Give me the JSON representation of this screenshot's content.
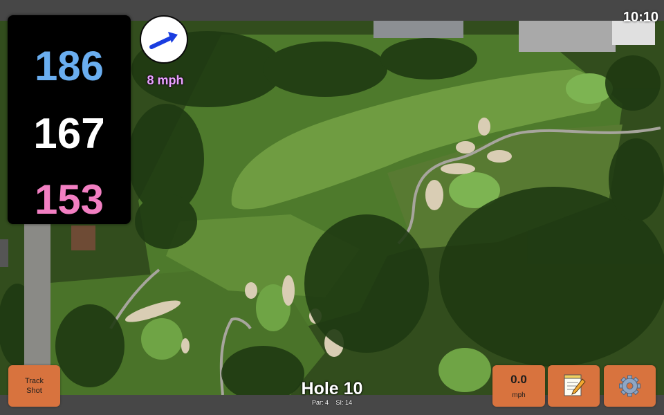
{
  "status_bar": {
    "time": "10:10"
  },
  "distances": {
    "back": "186",
    "middle": "167",
    "front": "153",
    "back_color": "#6aaef0",
    "middle_color": "#ffffff",
    "front_color": "#f27fc2"
  },
  "wind": {
    "speed": "8 mph",
    "direction_icon": "arrow-northeast-icon"
  },
  "track_button": {
    "label_line1": "Track",
    "label_line2": "Shot"
  },
  "speed_button": {
    "value": "0.0",
    "unit": "mph"
  },
  "notes_button": {
    "icon": "notepad-pencil-icon"
  },
  "settings_button": {
    "icon": "gear-icon"
  },
  "hole": {
    "title": "Hole 10",
    "par": "Par: 4",
    "stroke_index": "SI: 14"
  },
  "colors": {
    "button_orange": "#d8733e",
    "panel_black": "#000000",
    "bar_gray": "#474747",
    "wind_text": "#e9a2ff",
    "arrow_blue": "#1a3de0"
  }
}
